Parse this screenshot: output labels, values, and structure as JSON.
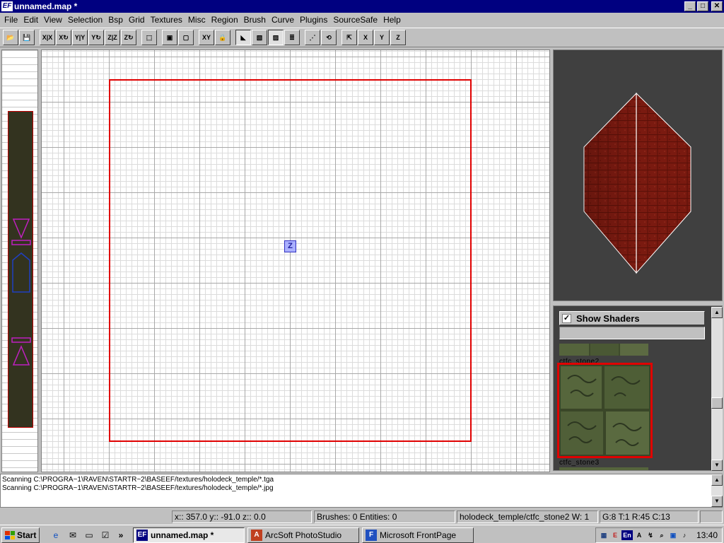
{
  "window": {
    "app_badge": "EF",
    "title": "unnamed.map *",
    "minimize": "_",
    "maximize": "□",
    "close": "✕"
  },
  "menu": [
    "File",
    "Edit",
    "View",
    "Selection",
    "Bsp",
    "Grid",
    "Textures",
    "Misc",
    "Region",
    "Brush",
    "Curve",
    "Plugins",
    "SourceSafe",
    "Help"
  ],
  "toolbar": [
    {
      "name": "open-icon",
      "glyph": "📂"
    },
    {
      "name": "save-icon",
      "glyph": "💾"
    },
    {
      "sep": true
    },
    {
      "name": "flip-x-icon",
      "glyph": "X|X"
    },
    {
      "name": "rotate-x-icon",
      "glyph": "X↻"
    },
    {
      "name": "flip-y-icon",
      "glyph": "Y|Y"
    },
    {
      "name": "rotate-y-icon",
      "glyph": "Y↻"
    },
    {
      "name": "flip-z-icon",
      "glyph": "Z|Z"
    },
    {
      "name": "rotate-z-icon",
      "glyph": "Z↻"
    },
    {
      "sep": true
    },
    {
      "name": "select-complete-tall-icon",
      "glyph": "⬚"
    },
    {
      "sep": true
    },
    {
      "name": "select-touching-icon",
      "glyph": "▣"
    },
    {
      "name": "select-inside-icon",
      "glyph": "▢"
    },
    {
      "sep": true
    },
    {
      "name": "change-view-icon",
      "glyph": "XY"
    },
    {
      "name": "texture-lock-icon",
      "glyph": "🔒"
    },
    {
      "sep": true
    },
    {
      "name": "clipper-icon",
      "glyph": "◣",
      "pressed": true
    },
    {
      "name": "cubic-clip-icon",
      "glyph": "▧"
    },
    {
      "name": "camera-preview-icon",
      "glyph": "▨",
      "pressed": true
    },
    {
      "name": "entity-list-icon",
      "glyph": "≣"
    },
    {
      "sep": true
    },
    {
      "name": "vertex-edit-icon",
      "glyph": "⋰"
    },
    {
      "name": "rotate-brush-icon",
      "glyph": "⟲"
    },
    {
      "sep": true
    },
    {
      "name": "scale-icon",
      "glyph": "⇱"
    },
    {
      "name": "axis-x-icon",
      "glyph": "X"
    },
    {
      "name": "axis-y-icon",
      "glyph": "Y"
    },
    {
      "name": "axis-z-icon",
      "glyph": "Z"
    }
  ],
  "xy_view": {
    "z_marker": "Z"
  },
  "texture_browser": {
    "show_shaders_label": "Show Shaders",
    "show_shaders_checked": "✓",
    "filter_value": "",
    "tex_above": "ctfc_stone2",
    "tex_selected": "ctfc_stone2",
    "tex_below": "ctfc_stone3"
  },
  "console": {
    "lines": [
      "Scanning C:\\PROGRA~1\\RAVEN\\STARTR~2\\BASEEF/textures/holodeck_temple/*.tga",
      "Scanning C:\\PROGRA~1\\RAVEN\\STARTR~2\\BASEEF/textures/holodeck_temple/*.jpg"
    ]
  },
  "status": {
    "coords": "x:: 357.0  y:: -91.0  z:: 0.0",
    "counts": "Brushes: 0 Entities: 0",
    "texture": "holodeck_temple/ctfc_stone2 W: 1",
    "grid": "G:8 T:1 R:45 C:13"
  },
  "taskbar": {
    "start": "Start",
    "tasks": [
      {
        "label": "unnamed.map *",
        "icon": "EF",
        "active": true
      },
      {
        "label": "ArcSoft PhotoStudio",
        "icon": "A",
        "active": false
      },
      {
        "label": "Microsoft FrontPage",
        "icon": "F",
        "active": false
      }
    ],
    "quicklaunch_more": "»",
    "tray_lang": "En",
    "clock": "13:40"
  },
  "colors": {
    "title_bar": "#000080",
    "brush_outline": "#e00000",
    "camera_brick": "#7a1a10",
    "texture_stone": "#4a5a38"
  }
}
